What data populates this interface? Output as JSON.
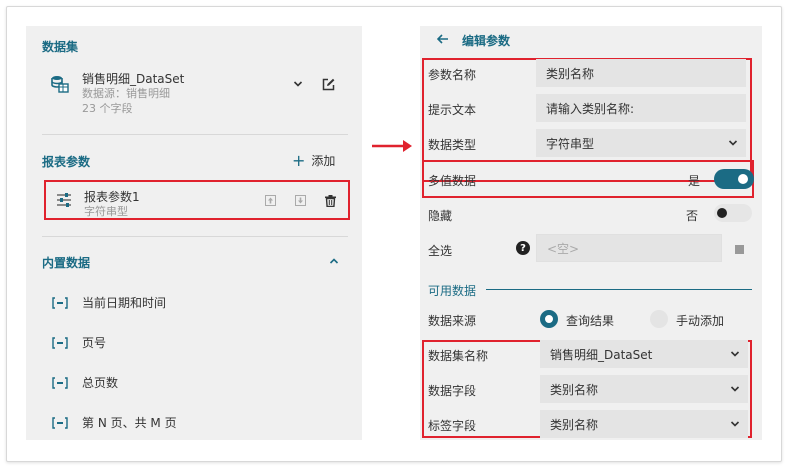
{
  "left": {
    "dataset_title": "数据集",
    "dataset": {
      "name": "销售明细_DataSet",
      "source": "数据源：销售明细",
      "field_count": "23 个字段"
    },
    "param_title": "报表参数",
    "add_label": "添加",
    "param": {
      "name": "报表参数1",
      "type": "字符串型"
    },
    "builtin_title": "内置数据",
    "builtin_items": [
      "当前日期和时间",
      "页号",
      "总页数",
      "第 N 页、共 M 页"
    ]
  },
  "right": {
    "back_title": "编辑参数",
    "fields": {
      "param_name": {
        "label": "参数名称",
        "value": "类别名称"
      },
      "prompt": {
        "label": "提示文本",
        "value": "请输入类别名称:"
      },
      "data_type": {
        "label": "数据类型",
        "value": "字符串型"
      },
      "multi": {
        "label": "多值数据",
        "state": "是",
        "on": true
      },
      "hidden": {
        "label": "隐藏",
        "state": "否",
        "on": false
      },
      "select_all": {
        "label": "全选",
        "placeholder": "<空>"
      }
    },
    "available_title": "可用数据",
    "source": {
      "label": "数据来源",
      "option_query": "查询结果",
      "option_manual": "手动添加"
    },
    "dataset_name": {
      "label": "数据集名称",
      "value": "销售明细_DataSet"
    },
    "data_field": {
      "label": "数据字段",
      "value": "类别名称"
    },
    "label_field": {
      "label": "标签字段",
      "value": "类别名称"
    }
  },
  "colors": {
    "accent": "#1b6b84",
    "highlight": "#e0222e",
    "panel": "#f0f0f0",
    "input": "#e4e4e4"
  }
}
